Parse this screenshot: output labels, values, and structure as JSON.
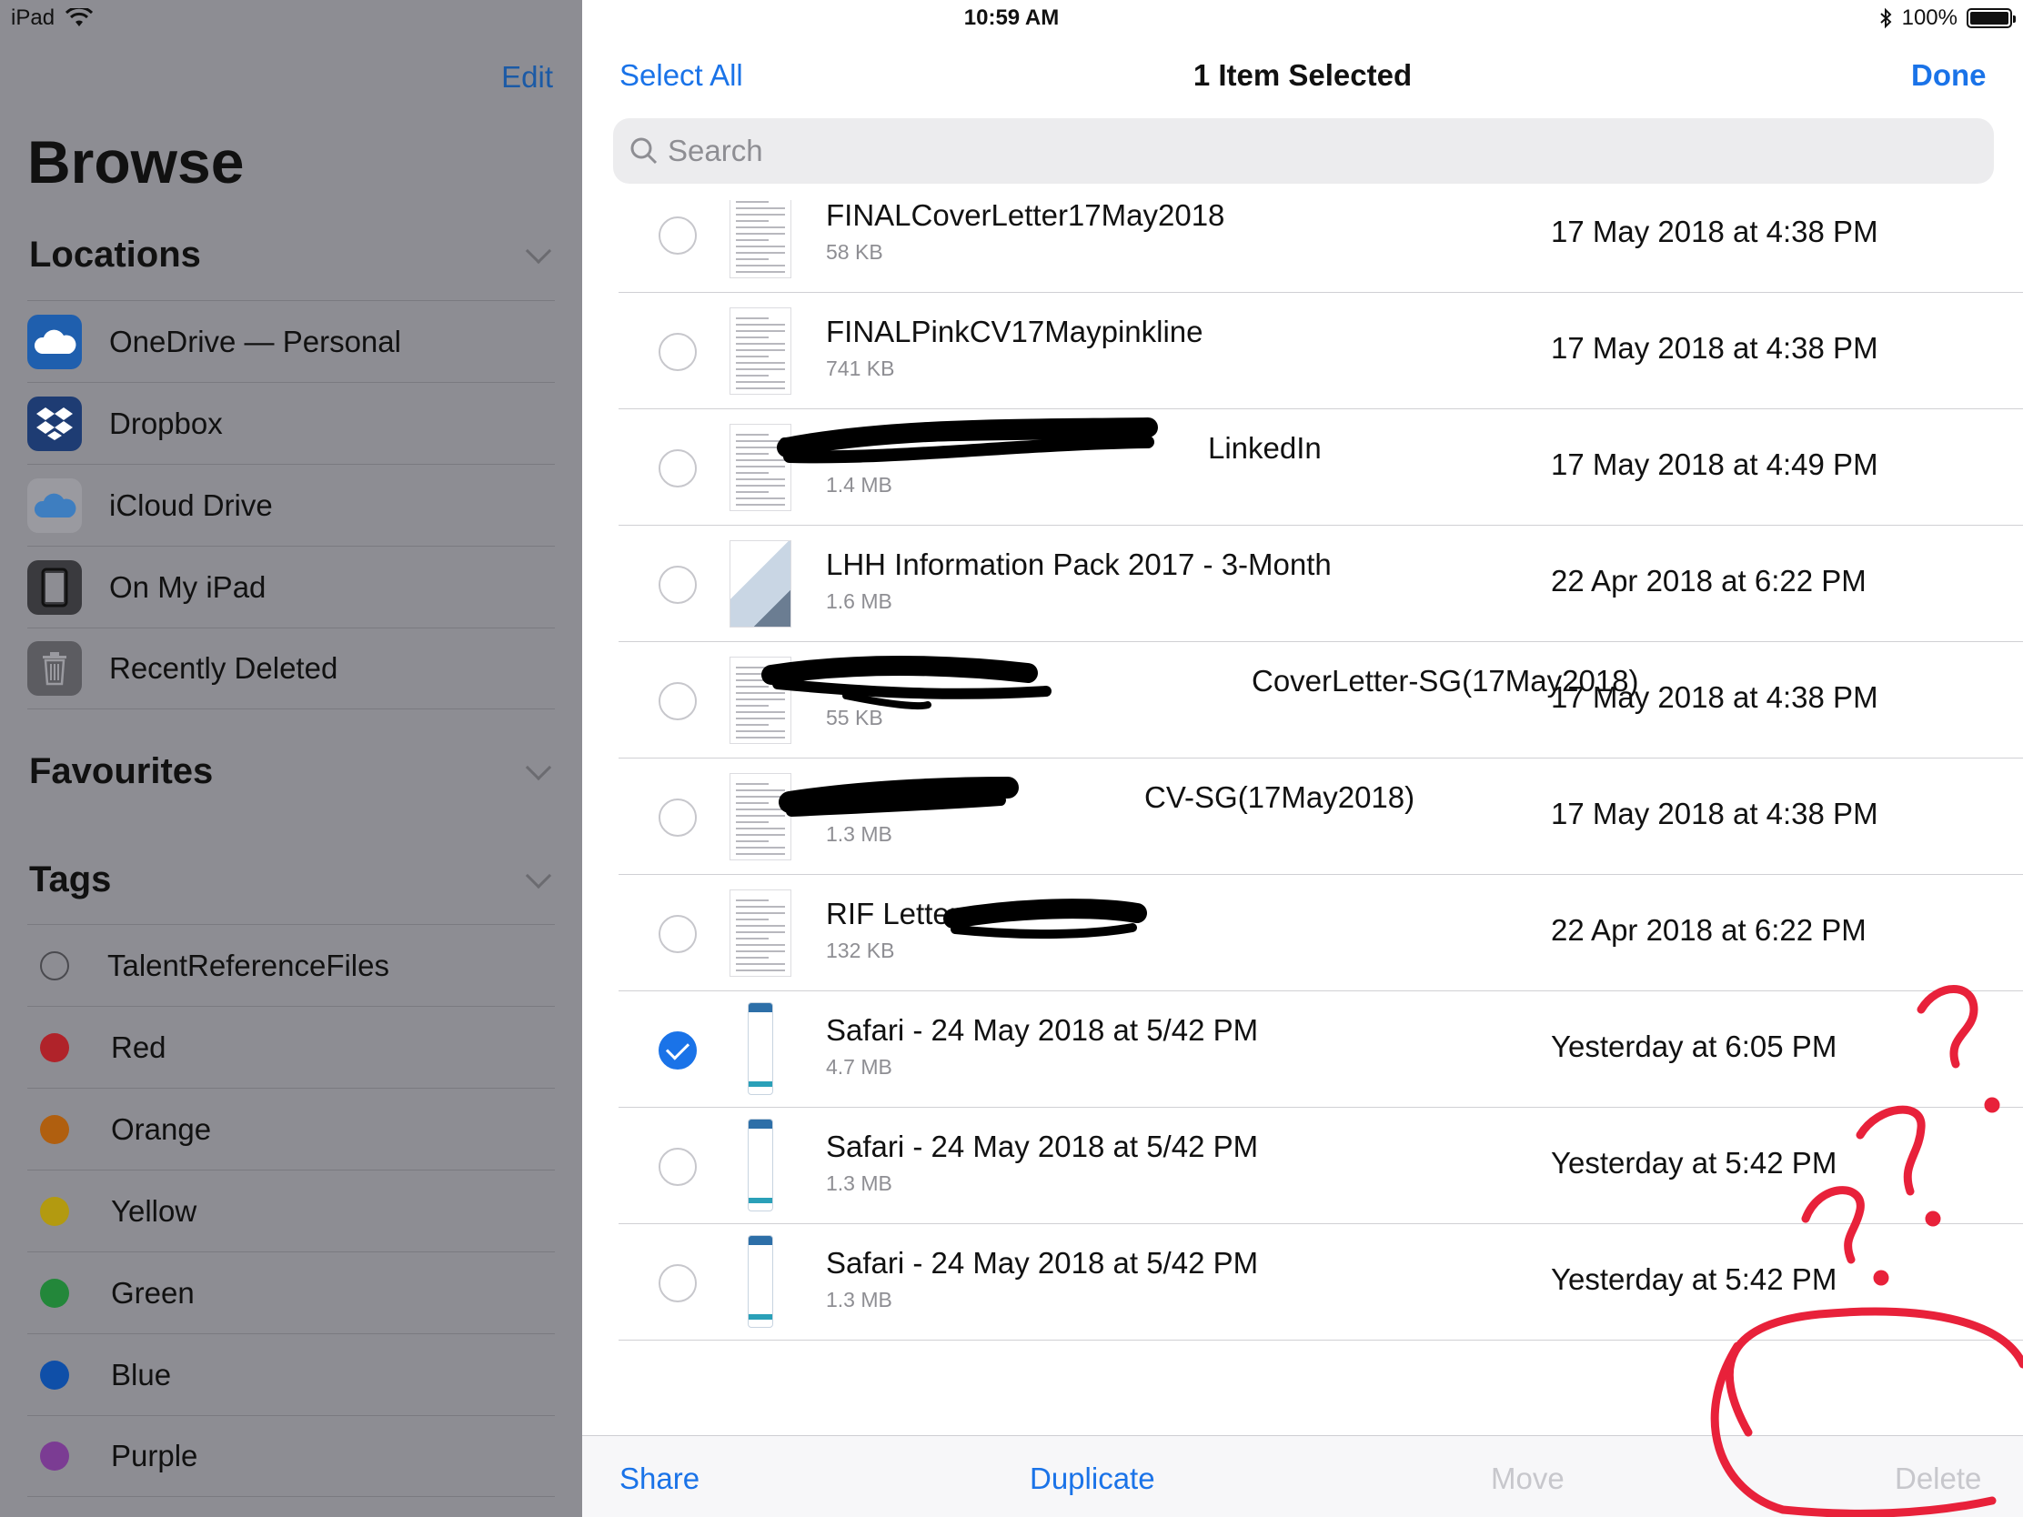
{
  "status_bar": {
    "device": "iPad",
    "time": "10:59 AM",
    "battery": "100%"
  },
  "sidebar": {
    "edit_label": "Edit",
    "title": "Browse",
    "locations": {
      "heading": "Locations",
      "items": [
        {
          "label": "OneDrive — Personal",
          "icon": "onedrive-icon"
        },
        {
          "label": "Dropbox",
          "icon": "dropbox-icon"
        },
        {
          "label": "iCloud Drive",
          "icon": "icloud-icon"
        },
        {
          "label": "On My iPad",
          "icon": "ipad-icon"
        },
        {
          "label": "Recently Deleted",
          "icon": "trash-icon"
        }
      ]
    },
    "favourites": {
      "heading": "Favourites"
    },
    "tags": {
      "heading": "Tags",
      "items": [
        {
          "label": "TalentReferenceFiles",
          "color": ""
        },
        {
          "label": "Red",
          "color": "#b0232a"
        },
        {
          "label": "Orange",
          "color": "#b05f0f"
        },
        {
          "label": "Yellow",
          "color": "#b39a10"
        },
        {
          "label": "Green",
          "color": "#23873a"
        },
        {
          "label": "Blue",
          "color": "#0f4fa8"
        },
        {
          "label": "Purple",
          "color": "#7b3c93"
        }
      ]
    }
  },
  "header": {
    "select_all_label": "Select All",
    "title": "1 Item Selected",
    "done_label": "Done",
    "search_placeholder": "Search"
  },
  "files": [
    {
      "name": "FINALCoverLetter17May2018",
      "size": "58 KB",
      "date": "17 May 2018 at 4:38 PM",
      "selected": false
    },
    {
      "name": "FINALPinkCV17Maypinkline",
      "size": "741 KB",
      "date": "17 May 2018 at 4:38 PM",
      "selected": false
    },
    {
      "name": "LinkedIn",
      "size": "1.4 MB",
      "date": "17 May 2018 at 4:49 PM",
      "selected": false
    },
    {
      "name": "LHH Information Pack 2017 - 3-Month",
      "size": "1.6 MB",
      "date": "22 Apr 2018 at 6:22 PM",
      "selected": false
    },
    {
      "name": "CoverLetter-SG(17May2018)",
      "size": "55 KB",
      "date": "17 May 2018 at 4:38 PM",
      "selected": false
    },
    {
      "name": "CV-SG(17May2018)",
      "size": "1.3 MB",
      "date": "17 May 2018 at 4:38 PM",
      "selected": false
    },
    {
      "name": "RIF Letter -",
      "size": "132 KB",
      "date": "22 Apr 2018 at 6:22 PM",
      "selected": false
    },
    {
      "name": "Safari - 24 May 2018 at 5/42 PM",
      "size": "4.7 MB",
      "date": "Yesterday at 6:05 PM",
      "selected": true
    },
    {
      "name": "Safari - 24 May 2018 at 5/42 PM",
      "size": "1.3 MB",
      "date": "Yesterday at 5:42 PM",
      "selected": false
    },
    {
      "name": "Safari - 24 May 2018 at 5/42 PM",
      "size": "1.3 MB",
      "date": "Yesterday at 5:42 PM",
      "selected": false
    }
  ],
  "toolbar": {
    "share_label": "Share",
    "duplicate_label": "Duplicate",
    "move_label": "Move",
    "delete_label": "Delete"
  },
  "colors": {
    "accent": "#1a73e8",
    "sidebar_bg": "#8d8d93",
    "annotation": "#e8213a",
    "disabled": "#c7c7cc"
  }
}
